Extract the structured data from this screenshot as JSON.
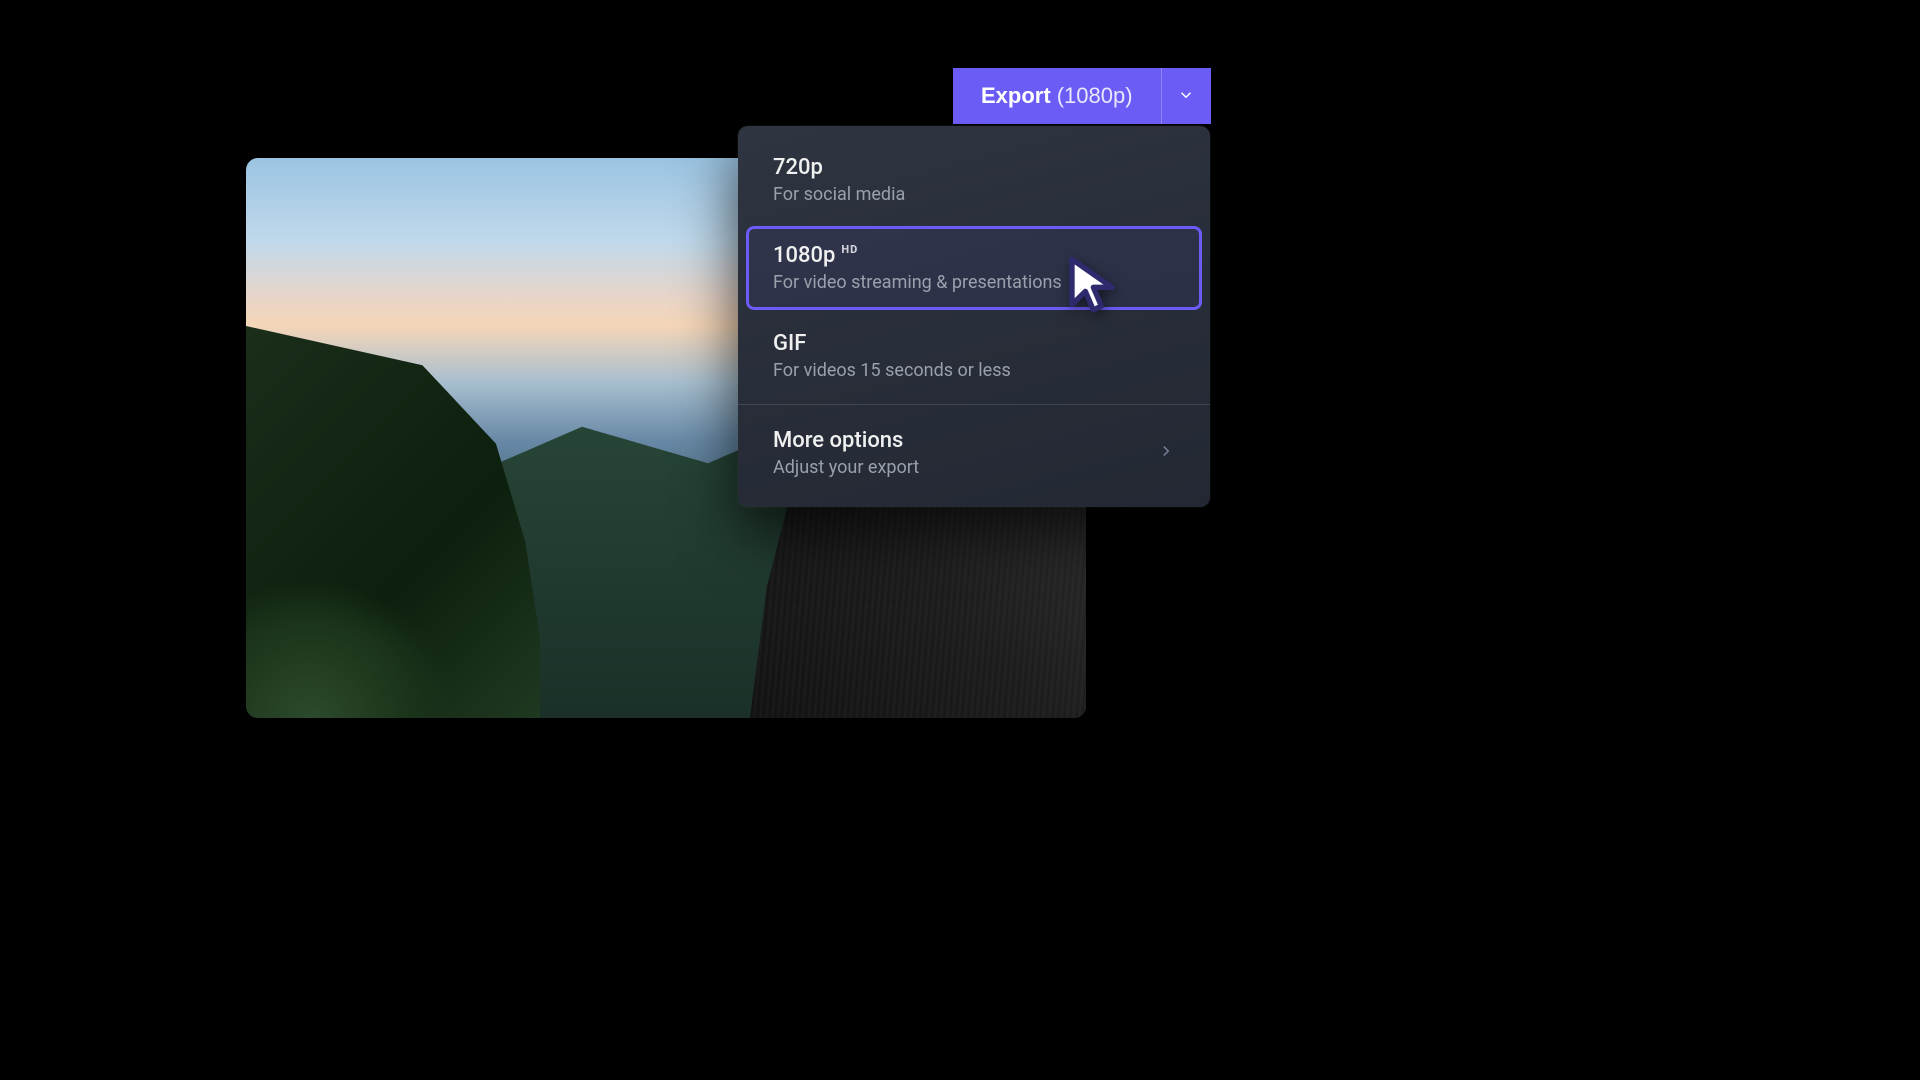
{
  "export_button": {
    "label": "Export",
    "resolution": "(1080p)"
  },
  "menu": {
    "items": [
      {
        "title": "720p",
        "badge": "",
        "desc": "For social media"
      },
      {
        "title": "1080p",
        "badge": "HD",
        "desc": "For video streaming & presentations"
      },
      {
        "title": "GIF",
        "badge": "",
        "desc": "For videos 15 seconds or less"
      }
    ],
    "more": {
      "title": "More options",
      "desc": "Adjust your export"
    },
    "selected_index": 1
  }
}
